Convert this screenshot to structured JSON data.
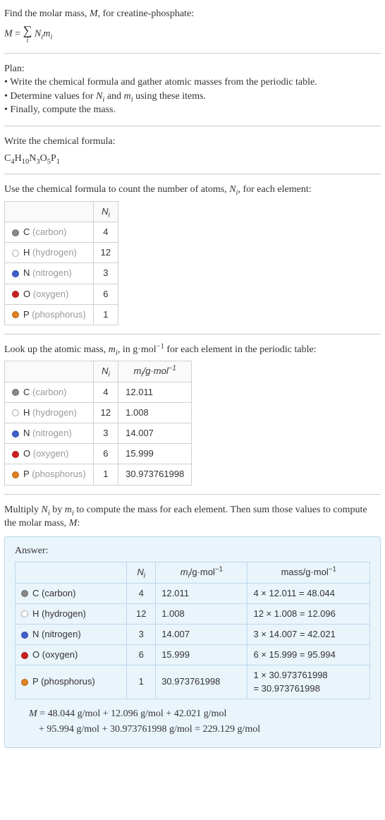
{
  "intro": {
    "line1_pre": "Find the molar mass, ",
    "line1_var": "M",
    "line1_post": ", for creatine-phosphate:",
    "eq_lhs": "M",
    "eq_eq": " = ",
    "eq_sigma_idx": "i",
    "eq_rhs_N": "N",
    "eq_rhs_i1": "i",
    "eq_rhs_m": "m",
    "eq_rhs_i2": "i"
  },
  "plan": {
    "heading": "Plan:",
    "b1_pre": "• Write the chemical formula and gather atomic masses from the periodic table.",
    "b2_pre": "• Determine values for ",
    "b2_n": "N",
    "b2_i1": "i",
    "b2_mid": " and ",
    "b2_m": "m",
    "b2_i2": "i",
    "b2_post": " using these items.",
    "b3": "• Finally, compute the mass."
  },
  "chem": {
    "heading": "Write the chemical formula:",
    "c": "C",
    "c_n": "4",
    "h": "H",
    "h_n": "10",
    "n": "N",
    "n_n": "3",
    "o": "O",
    "o_n": "5",
    "p": "P",
    "p_n": "1"
  },
  "count": {
    "heading_pre": "Use the chemical formula to count the number of atoms, ",
    "heading_var": "N",
    "heading_i": "i",
    "heading_post": ", for each element:",
    "col_n": "N",
    "col_n_i": "i",
    "rows": [
      {
        "sym": "C",
        "name": "(carbon)",
        "dot": "dot-c",
        "n": "4"
      },
      {
        "sym": "H",
        "name": "(hydrogen)",
        "dot": "dot-h",
        "n": "12"
      },
      {
        "sym": "N",
        "name": "(nitrogen)",
        "dot": "dot-n",
        "n": "3"
      },
      {
        "sym": "O",
        "name": "(oxygen)",
        "dot": "dot-o",
        "n": "6"
      },
      {
        "sym": "P",
        "name": "(phosphorus)",
        "dot": "dot-p",
        "n": "1"
      }
    ]
  },
  "mass": {
    "heading_pre": "Look up the atomic mass, ",
    "heading_m": "m",
    "heading_i": "i",
    "heading_mid": ", in g·mol",
    "heading_exp": "−1",
    "heading_post": " for each element in the periodic table:",
    "col_n": "N",
    "col_n_i": "i",
    "col_m": "m",
    "col_m_i": "i",
    "col_unit_pre": "/g·mol",
    "col_unit_exp": "−1",
    "rows": [
      {
        "sym": "C",
        "name": "(carbon)",
        "dot": "dot-c",
        "n": "4",
        "m": "12.011"
      },
      {
        "sym": "H",
        "name": "(hydrogen)",
        "dot": "dot-h",
        "n": "12",
        "m": "1.008"
      },
      {
        "sym": "N",
        "name": "(nitrogen)",
        "dot": "dot-n",
        "n": "3",
        "m": "14.007"
      },
      {
        "sym": "O",
        "name": "(oxygen)",
        "dot": "dot-o",
        "n": "6",
        "m": "15.999"
      },
      {
        "sym": "P",
        "name": "(phosphorus)",
        "dot": "dot-p",
        "n": "1",
        "m": "30.973761998"
      }
    ]
  },
  "multiply": {
    "pre": "Multiply ",
    "n": "N",
    "ni": "i",
    "mid1": " by ",
    "m": "m",
    "mi": "i",
    "mid2": " to compute the mass for each element. Then sum those values to compute the molar mass, ",
    "mvar": "M",
    "post": ":"
  },
  "answer": {
    "label": "Answer:",
    "col_n": "N",
    "col_n_i": "i",
    "col_m": "m",
    "col_m_i": "i",
    "col_unit_pre": "/g·mol",
    "col_unit_exp": "−1",
    "col_mass_pre": "mass/g·mol",
    "col_mass_exp": "−1",
    "rows": [
      {
        "sym": "C",
        "name": "(carbon)",
        "dot": "dot-c",
        "n": "4",
        "m": "12.011",
        "mass": "4 × 12.011 = 48.044"
      },
      {
        "sym": "H",
        "name": "(hydrogen)",
        "dot": "dot-h",
        "n": "12",
        "m": "1.008",
        "mass": "12 × 1.008 = 12.096"
      },
      {
        "sym": "N",
        "name": "(nitrogen)",
        "dot": "dot-n",
        "n": "3",
        "m": "14.007",
        "mass": "3 × 14.007 = 42.021"
      },
      {
        "sym": "O",
        "name": "(oxygen)",
        "dot": "dot-o",
        "n": "6",
        "m": "15.999",
        "mass": "6 × 15.999 = 95.994"
      },
      {
        "sym": "P",
        "name": "(phosphorus)",
        "dot": "dot-p",
        "n": "1",
        "m": "30.973761998",
        "mass_l1": "1 × 30.973761998",
        "mass_l2": "= 30.973761998"
      }
    ],
    "sum_l1_pre": "M",
    "sum_l1": " = 48.044 g/mol + 12.096 g/mol + 42.021 g/mol",
    "sum_l2": "+ 95.994 g/mol + 30.973761998 g/mol = 229.129 g/mol"
  }
}
